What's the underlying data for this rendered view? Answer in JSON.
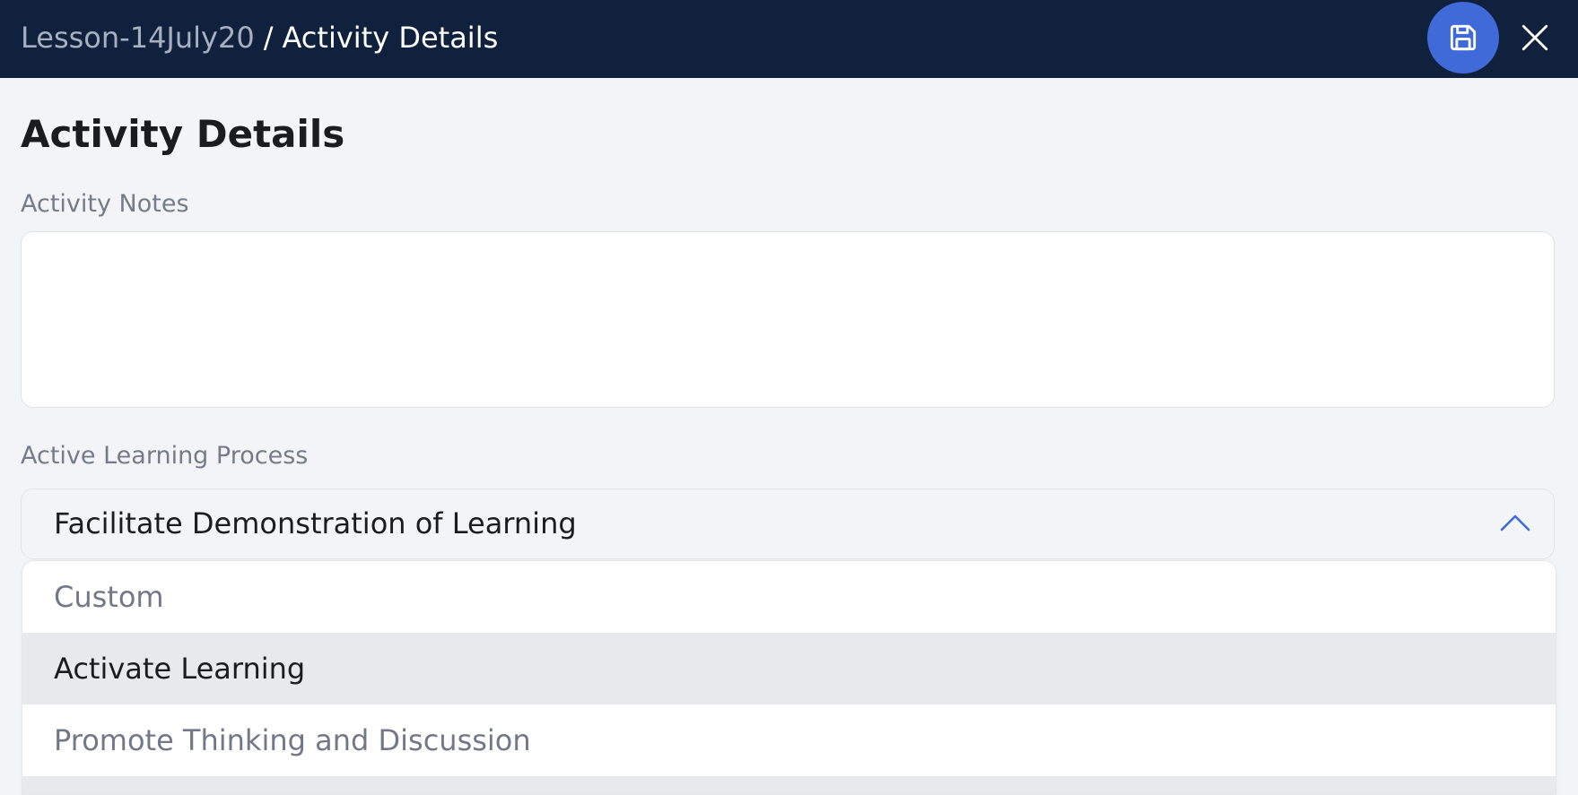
{
  "header": {
    "breadcrumb_parent": "Lesson-14July20",
    "breadcrumb_separator": "/",
    "breadcrumb_current": "Activity Details",
    "save_icon": "save-icon",
    "close_icon": "close-icon"
  },
  "page": {
    "title": "Activity Details"
  },
  "activity_notes": {
    "label": "Activity Notes",
    "value": "",
    "placeholder": ""
  },
  "learning_process": {
    "label": "Active Learning Process",
    "selected": "Facilitate Demonstration of Learning",
    "expanded": true,
    "options": [
      {
        "label": "Custom",
        "state": "normal"
      },
      {
        "label": "Activate Learning",
        "state": "highlighted"
      },
      {
        "label": "Promote Thinking and Discussion",
        "state": "normal"
      }
    ]
  },
  "colors": {
    "header_bg": "#0f213d",
    "accent": "#3f6ad8",
    "page_bg": "#f3f4f8",
    "highlight_bg": "#e8e9ed"
  }
}
